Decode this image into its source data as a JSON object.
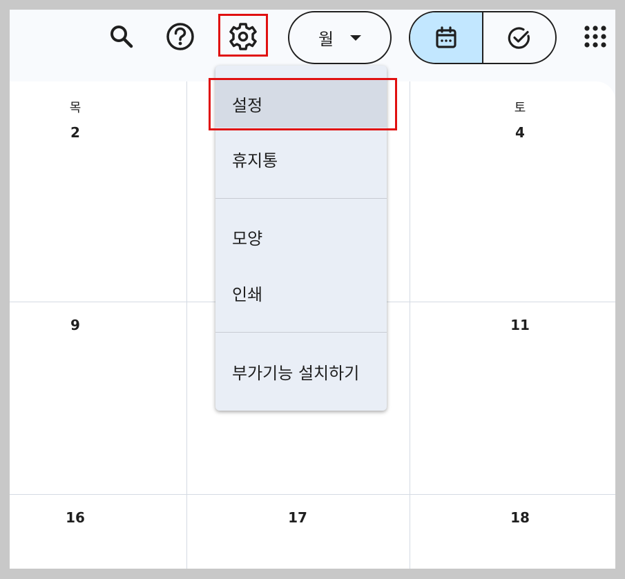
{
  "toolbar": {
    "search_icon": "search-icon",
    "help_icon": "help-icon",
    "settings_icon": "gear-icon",
    "view_selector_label": "월",
    "calendar_toggle_icon": "calendar-icon",
    "tasks_toggle_icon": "task-check-icon",
    "apps_icon": "apps-grid-icon"
  },
  "calendar": {
    "day_headers": [
      "목",
      "토"
    ],
    "week1": [
      "2",
      "4"
    ],
    "week2": [
      "9",
      "11"
    ],
    "week3": [
      "16",
      "17",
      "18"
    ]
  },
  "settings_menu": {
    "items": [
      "설정",
      "휴지통",
      "모양",
      "인쇄",
      "부가기능 설치하기"
    ]
  },
  "colors": {
    "accent_selected": "#c2e7ff",
    "highlight_box": "#e01010",
    "menu_bg": "#e9eef6"
  }
}
